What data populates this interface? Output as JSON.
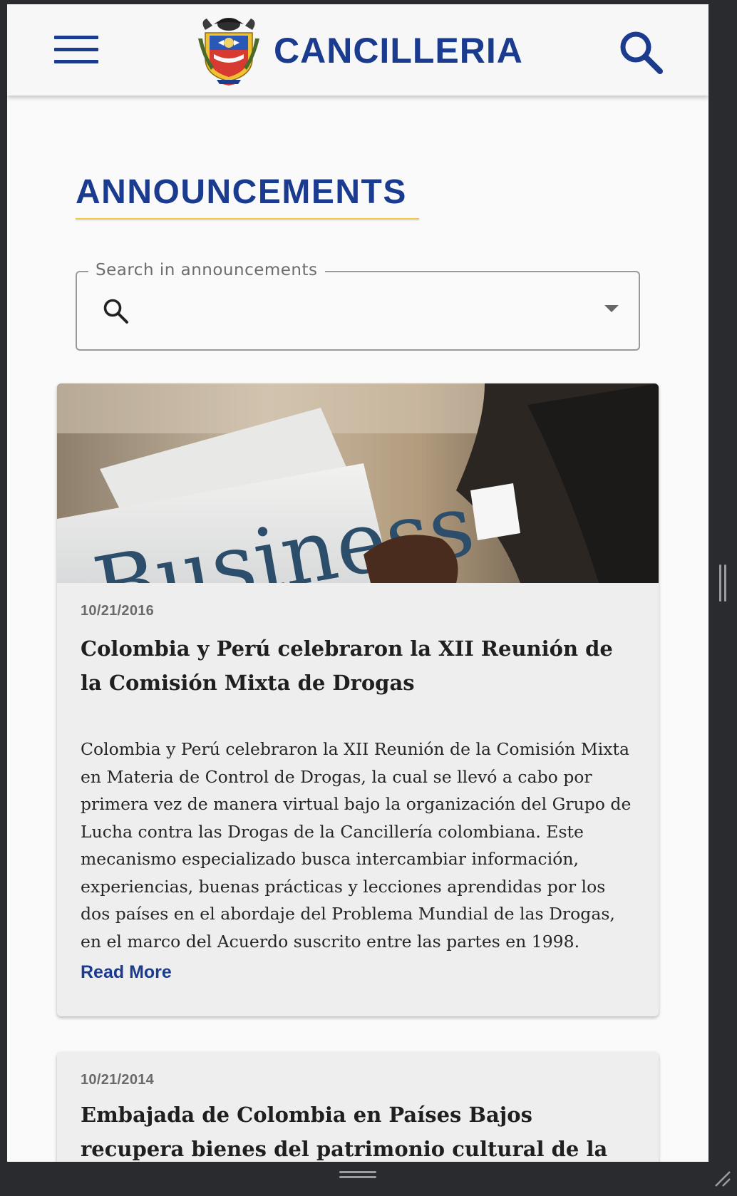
{
  "header": {
    "brand": "CANCILLERIA",
    "menu_icon": "hamburger-menu-icon",
    "search_icon": "magnifier-icon",
    "logo_icon": "colombia-coat-of-arms-icon"
  },
  "main": {
    "title": "ANNOUNCEMENTS",
    "search": {
      "label": "Search in announcements",
      "value": "",
      "icon": "magnifier-icon",
      "caret_icon": "caret-down-icon"
    },
    "announcements": [
      {
        "date": "10/21/2016",
        "title": "Colombia y Perú celebraron la XII Reunión de la Comisión Mixta de Drogas",
        "body": "Colombia y Perú celebraron la XII Reunión de la Comisión Mixta en Materia de Control de Drogas, la cual se llevó a cabo por primera vez de manera virtual bajo la organización del Grupo de Lucha contra las Drogas de la Cancillería colombiana. Este mecanismo especializado busca intercambiar información, experiencias, buenas prácticas y lecciones aprendidas por los dos países en el abordaje del Problema Mundial de las Drogas, en el marco del Acuerdo suscrito entre las partes en 1998.",
        "read_more": "Read More",
        "image_text": "Business"
      },
      {
        "date": "10/21/2014",
        "title": "Embajada de Colombia en Países Bajos recupera bienes del patrimonio cultural de la Nación"
      }
    ]
  },
  "colors": {
    "brand_blue": "#1b3b8f",
    "accent_yellow": "#f2c744",
    "card_bg": "#eeeeee",
    "frame_dark": "#2a2b2e"
  }
}
